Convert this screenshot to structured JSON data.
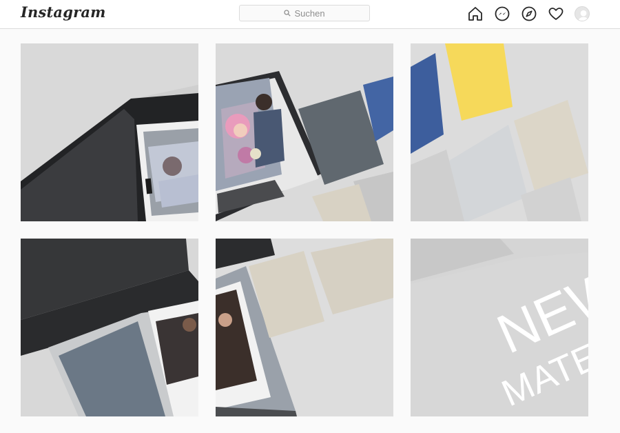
{
  "header": {
    "logo_text": "Instagram",
    "search_placeholder": "Suchen",
    "nav_icons": [
      "home-icon",
      "messenger-icon",
      "explore-icon",
      "activity-heart-icon",
      "profile-avatar-icon"
    ]
  },
  "posts": [
    {
      "content": "black presentation box with wedding print"
    },
    {
      "content": "wedding couple photo box with grey album covers"
    },
    {
      "content": "blue, yellow, light grey and linen album covers"
    },
    {
      "content": "dark grey box and grey linen folder"
    },
    {
      "content": "portrait photo in mat with beige linen covers"
    },
    {
      "content": "grey background with overlay text",
      "overlay_line1": "NEW",
      "overlay_line2": "MATERIALS"
    }
  ],
  "colors": {
    "accent_yellow": "#f5d960",
    "accent_blue": "#4065a6",
    "slate_grey": "#6c7985",
    "linen_beige": "#d8d2c4",
    "dark_box": "#3a3b3d"
  }
}
